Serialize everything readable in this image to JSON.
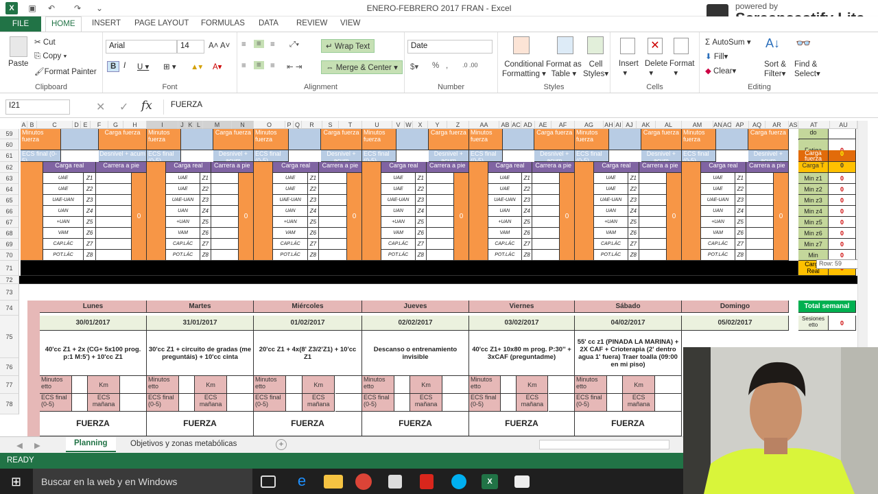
{
  "window": {
    "title": "ENERO-FEBRERO 2017 FRAN - Excel",
    "watermark_small": "powered by",
    "watermark": "Screencastify Lite"
  },
  "tabs": {
    "file": "FILE",
    "items": [
      "HOME",
      "INSERT",
      "PAGE LAYOUT",
      "FORMULAS",
      "DATA",
      "REVIEW",
      "VIEW"
    ]
  },
  "ribbon": {
    "clipboard": {
      "paste": "Paste",
      "cut": "Cut",
      "copy": "Copy",
      "format_painter": "Format Painter",
      "label": "Clipboard"
    },
    "font": {
      "name": "Arial",
      "size": "14",
      "label": "Font"
    },
    "alignment": {
      "wrap": "Wrap Text",
      "merge": "Merge & Center",
      "label": "Alignment"
    },
    "number": {
      "format": "Date",
      "label": "Number"
    },
    "styles": {
      "cond": "Conditional",
      "cond2": "Formatting",
      "format_as": "Format as",
      "table": "Table",
      "cell": "Cell",
      "styles_btn": "Styles",
      "label": "Styles"
    },
    "cells": {
      "insert": "Insert",
      "delete": "Delete",
      "format": "Format",
      "label": "Cells"
    },
    "editing": {
      "autosum": "AutoSum",
      "fill": "Fill",
      "clear": "Clear",
      "sort": "Sort &",
      "filter": "Filter",
      "find": "Find &",
      "select": "Select",
      "label": "Editing"
    }
  },
  "formula_bar": {
    "cell_ref": "I21",
    "fx": "fx",
    "value": "FUERZA"
  },
  "columns": [
    "A",
    "B",
    "C",
    "D",
    "E",
    "F",
    "G",
    "H",
    "I",
    "J",
    "K",
    "L",
    "M",
    "N",
    "O",
    "P",
    "Q",
    "R",
    "S",
    "T",
    "U",
    "V",
    "W",
    "X",
    "Y",
    "Z",
    "AA",
    "AB",
    "AC",
    "AD",
    "AE",
    "AF",
    "AG",
    "AH",
    "AI",
    "AJ",
    "AK",
    "AL",
    "AM",
    "AN",
    "AO",
    "AP",
    "AQ",
    "AR",
    "AS",
    "AT",
    "AU"
  ],
  "rows": [
    "59",
    "60",
    "61",
    "62",
    "63",
    "64",
    "65",
    "66",
    "67",
    "68",
    "69",
    "70",
    "71",
    "72",
    "73",
    "74",
    "75",
    "76",
    "77",
    "78"
  ],
  "block": {
    "min_fuerza": "Minutos fuerza",
    "carga_fuerza": "Carga fuerza",
    "ecs_final": "ECS final (0-5)",
    "desnivel": "Desnivel + acum",
    "carga_real": "Carga real",
    "carrera": "Carrera a pie",
    "zero": "0",
    "zone_codes": [
      "UAE",
      "UAE",
      "UAE-UAN",
      "UAN",
      "+UAN",
      "VAM",
      "CAP.LÁC",
      "POT.LÁC"
    ],
    "zones": [
      "Z1",
      "Z2",
      "Z3",
      "Z4",
      "Z5",
      "Z6",
      "Z7",
      "Z8"
    ]
  },
  "side": {
    "top": "do",
    "fatiga": "Fatiga",
    "carga_fuerza": "Carga fuerza",
    "carga_t": "Carga T",
    "mins": [
      "Min z1",
      "Min z2",
      "Min z3",
      "Min z4",
      "Min z5",
      "Min z6",
      "Min z7",
      "Min"
    ],
    "carga_real": "Carga Real",
    "zero": "0",
    "tooltip": "Row: 59",
    "total": "Total semanal",
    "sesiones": "Sesiones etto"
  },
  "week": {
    "days": [
      "Lunes",
      "Martes",
      "Miércoles",
      "Jueves",
      "Viernes",
      "Sábado",
      "Domingo"
    ],
    "dates": [
      "30/01/2017",
      "31/01/2017",
      "01/02/2017",
      "02/02/2017",
      "03/02/2017",
      "04/02/2017",
      "05/02/2017"
    ],
    "sessions": [
      "40'cc Z1 + 2x (CG+ 5x100 prog. p:1 M:5') + 10'cc Z1",
      "30'cc Z1 + circuito de gradas (me preguntáis) + 10'cc cinta",
      "20'cc Z1 + 4x(8' Z3/2'Z1) + 10'cc Z1",
      "Descanso o entrenamiento invisible",
      "40'cc Z1+ 10x80 m prog. P:30'' + 3xCAF (preguntadme)",
      "55' cc z1 (PINADA LA MARINA) + 2X CAF + Crioterapia (2' dentro agua 1' fuera) Traer toalla (09:00 en mi piso)",
      ""
    ],
    "min_etto": "Minutos etto",
    "km": "Km",
    "ecs_final": "ECS final (0-5)",
    "ecs_manana": "ECS mañana",
    "fuerza": "FUERZA"
  },
  "sheets": {
    "active": "Planning",
    "other": "Objetivos y zonas metabólicas"
  },
  "status": {
    "ready": "READY"
  },
  "taskbar": {
    "search": "Buscar en la web y en Windows"
  }
}
